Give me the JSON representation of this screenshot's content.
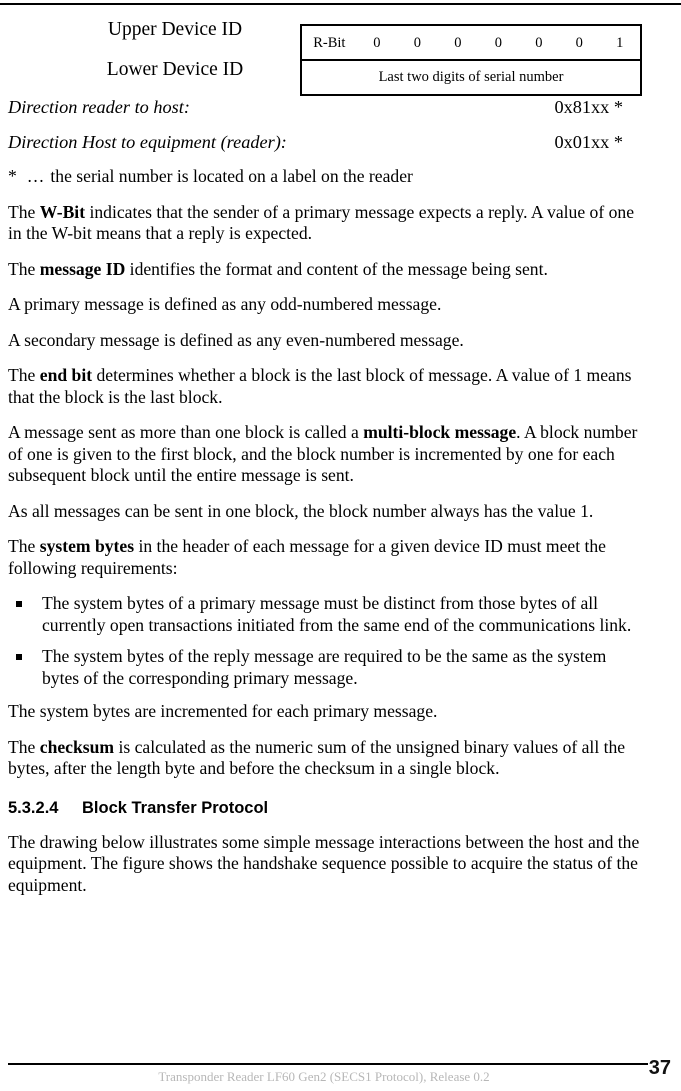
{
  "document": {
    "page_number": "37",
    "footer_text": "Transponder Reader LF60 Gen2 (SECS1 Protocol), Release 0.2"
  },
  "device_id_figure": {
    "upper_label": "Upper Device ID",
    "lower_label": "Lower Device ID",
    "upper_row": [
      "R-Bit",
      "0",
      "0",
      "0",
      "0",
      "0",
      "0",
      "1"
    ],
    "lower_row": "Last two digits of serial number"
  },
  "directions": [
    {
      "label": "Direction reader to host:",
      "value": "0x81xx *"
    },
    {
      "label": "Direction Host to equipment (reader):",
      "value": "0x01xx *"
    }
  ],
  "footnote": {
    "star": "*",
    "ellipsis": "…",
    "text": "the serial number is located on a label on the reader"
  },
  "paragraphs": {
    "w_bit": {
      "lead": "The ",
      "bold": "W-Bit",
      "rest": " indicates that the sender of a primary message expects a reply. A value of one in the W-bit means that a reply is expected."
    },
    "message_id": {
      "lead": "The ",
      "bold": "message ID",
      "rest": " identifies the format and content of the message being sent."
    },
    "primary_message": "A primary message is defined as any odd-numbered message.",
    "secondary_message": "A secondary message is defined as any even-numbered message.",
    "end_bit": {
      "lead": "The ",
      "bold": "end bit",
      "rest": " determines whether a block is the last block of message. A value of 1 means that the block is the last block."
    },
    "multi_block": {
      "lead": "A message sent as more than one block is called a ",
      "bold": "multi-block message",
      "rest": ". A block number of one is given to the first block, and the block number is incremented by one for each subsequent block until the entire message is sent."
    },
    "block_number_value": "As all messages can be sent in one block, the block number always has the value 1.",
    "system_bytes_intro": {
      "lead": "The ",
      "bold": "system bytes",
      "rest": " in the header of each message for a given device ID must meet the following requirements:"
    },
    "system_bytes_incremented": "The system bytes are incremented for each primary message.",
    "checksum": {
      "lead": "The ",
      "bold": "checksum",
      "rest": " is calculated as the numeric sum of the unsigned binary values of all the bytes, after the length byte and before the checksum in a single block."
    },
    "block_transfer_intro": "The drawing below illustrates some simple message interactions between the host and the equipment. The figure shows the handshake sequence possible to acquire the status of the equipment."
  },
  "system_bytes_requirements": [
    "The system bytes of a primary message must be distinct from those bytes of all currently open transactions initiated from the same end of the communications link.",
    "The system bytes of the reply message are required to be the same as the system bytes of the corresponding primary message."
  ],
  "section": {
    "number": "5.3.2.4",
    "title": "Block Transfer Protocol"
  }
}
